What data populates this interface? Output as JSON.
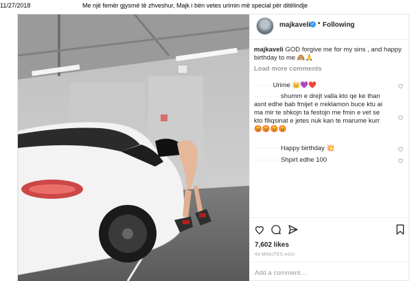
{
  "print_header": {
    "date": "11/27/2018",
    "title": "Me një femër gjysmë të zhveshur, Majk i bën vetes urimin më special për ditëlindje"
  },
  "post": {
    "username": "majkaveli",
    "separator": "•",
    "follow_label": "Following",
    "caption_user": "majkaveli",
    "caption_text": "GOD forgive me for my sins , and happy birthday to me 🙈🙏",
    "load_more": "Load more comments",
    "comments": [
      {
        "text": "Urime 👑💜❤️"
      },
      {
        "text": "shumm e drejt valla kto qe ke than asnt edhe bab fmijet e rreklamon buce ktu ai ma mir te shkojn ta festojn me fmin e vet se kto flliqsinat e jetes nuk kan te marume kurr 😡😡😡😡"
      },
      {
        "text": "Happy birthday 💥"
      },
      {
        "text": "Shpirt edhe 100"
      }
    ],
    "likes": "7,602 likes",
    "time": "43 MINUTES AGO",
    "add_comment_placeholder": "Add a comment…"
  },
  "icons": {
    "verified": "verified-badge-icon",
    "like": "heart-outline-icon",
    "comment": "speech-bubble-icon",
    "share": "paper-plane-icon",
    "save": "bookmark-icon"
  },
  "colors": {
    "verified": "#3897f0",
    "muted": "#999999",
    "text": "#262626"
  }
}
